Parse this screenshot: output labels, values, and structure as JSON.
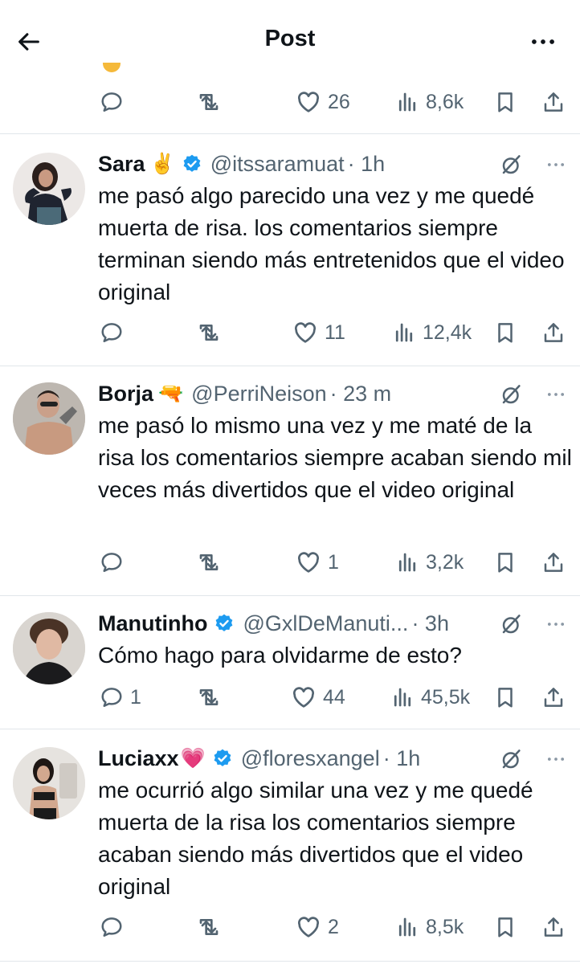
{
  "header": {
    "title": "Post"
  },
  "top_actions": {
    "likes": "26",
    "views": "8,6k"
  },
  "replies": [
    {
      "name": "Sara",
      "name_emoji": "✌️",
      "verified": true,
      "handle": "@itssaramuat",
      "time": "· 1h",
      "text": "me pasó algo parecido una vez y me quedé muerta de risa. los comentarios siempre terminan siendo más entretenidos que el video original",
      "replies_count": "",
      "likes": "11",
      "views": "12,4k"
    },
    {
      "name": "Borja",
      "name_emoji": "🔫",
      "verified": false,
      "handle": "@PerriNeison",
      "time": "· 23 m",
      "text": "me pasó lo mismo una vez y me maté de la risa los comentarios siempre acaban siendo mil veces más divertidos que el video original",
      "replies_count": "",
      "likes": "1",
      "views": "3,2k"
    },
    {
      "name": "Manutinho",
      "name_emoji": "",
      "verified": true,
      "handle": "@GxlDeManuti...",
      "time": "· 3h",
      "text": "Cómo hago para olvidarme de esto?",
      "replies_count": "1",
      "likes": "44",
      "views": "45,5k"
    },
    {
      "name": "Luciaxx",
      "name_emoji": "💗",
      "verified": true,
      "handle": "@floresxangel",
      "time": "· 1h",
      "text": "me ocurrió algo similar una vez y me quedé muerta de la risa los comentarios siempre acaban siendo más divertidos que el video original",
      "replies_count": "",
      "likes": "2",
      "views": "8,5k"
    }
  ]
}
